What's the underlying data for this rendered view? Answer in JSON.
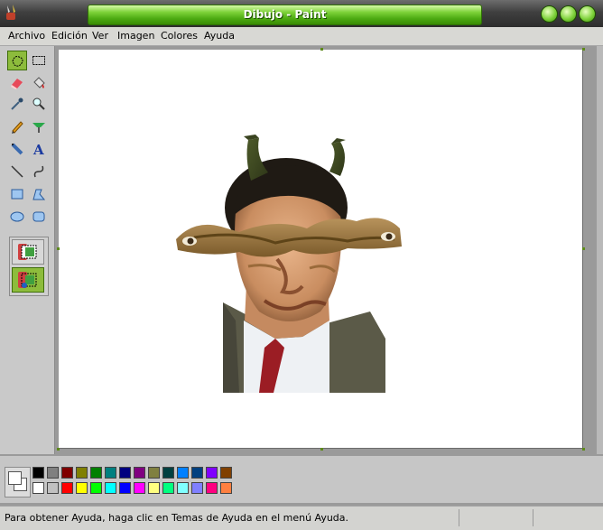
{
  "window": {
    "title": "Dibujo - Paint"
  },
  "menu": [
    "Archivo",
    "Edición",
    "Ver",
    "Imagen",
    "Colores",
    "Ayuda"
  ],
  "tools": [
    {
      "name": "free-form-select-icon",
      "active": true
    },
    {
      "name": "rect-select-icon",
      "active": false
    },
    {
      "name": "eraser-icon",
      "active": false
    },
    {
      "name": "fill-bucket-icon",
      "active": false
    },
    {
      "name": "color-picker-icon",
      "active": false
    },
    {
      "name": "magnifier-icon",
      "active": false
    },
    {
      "name": "pencil-icon",
      "active": false
    },
    {
      "name": "brush-icon",
      "active": false
    },
    {
      "name": "airbrush-icon",
      "active": false
    },
    {
      "name": "text-icon",
      "active": false,
      "glyph": "A"
    },
    {
      "name": "line-icon",
      "active": false
    },
    {
      "name": "curve-icon",
      "active": false
    },
    {
      "name": "rectangle-icon",
      "active": false
    },
    {
      "name": "polygon-icon",
      "active": false
    },
    {
      "name": "ellipse-icon",
      "active": false
    },
    {
      "name": "rounded-rect-icon",
      "active": false
    }
  ],
  "palette_top": [
    "#000000",
    "#808080",
    "#800000",
    "#808000",
    "#008000",
    "#008080",
    "#000080",
    "#800080",
    "#808040",
    "#004040",
    "#0080ff",
    "#004080",
    "#8000ff",
    "#804000"
  ],
  "palette_bottom": [
    "#ffffff",
    "#c0c0c0",
    "#ff0000",
    "#ffff00",
    "#00ff00",
    "#00ffff",
    "#0000ff",
    "#ff00ff",
    "#ffff80",
    "#00ff80",
    "#80ffff",
    "#8080ff",
    "#ff0080",
    "#ff8040"
  ],
  "status": {
    "text": "Para obtener Ayuda, haga clic en Temas de Ayuda en el menú Ayuda."
  }
}
